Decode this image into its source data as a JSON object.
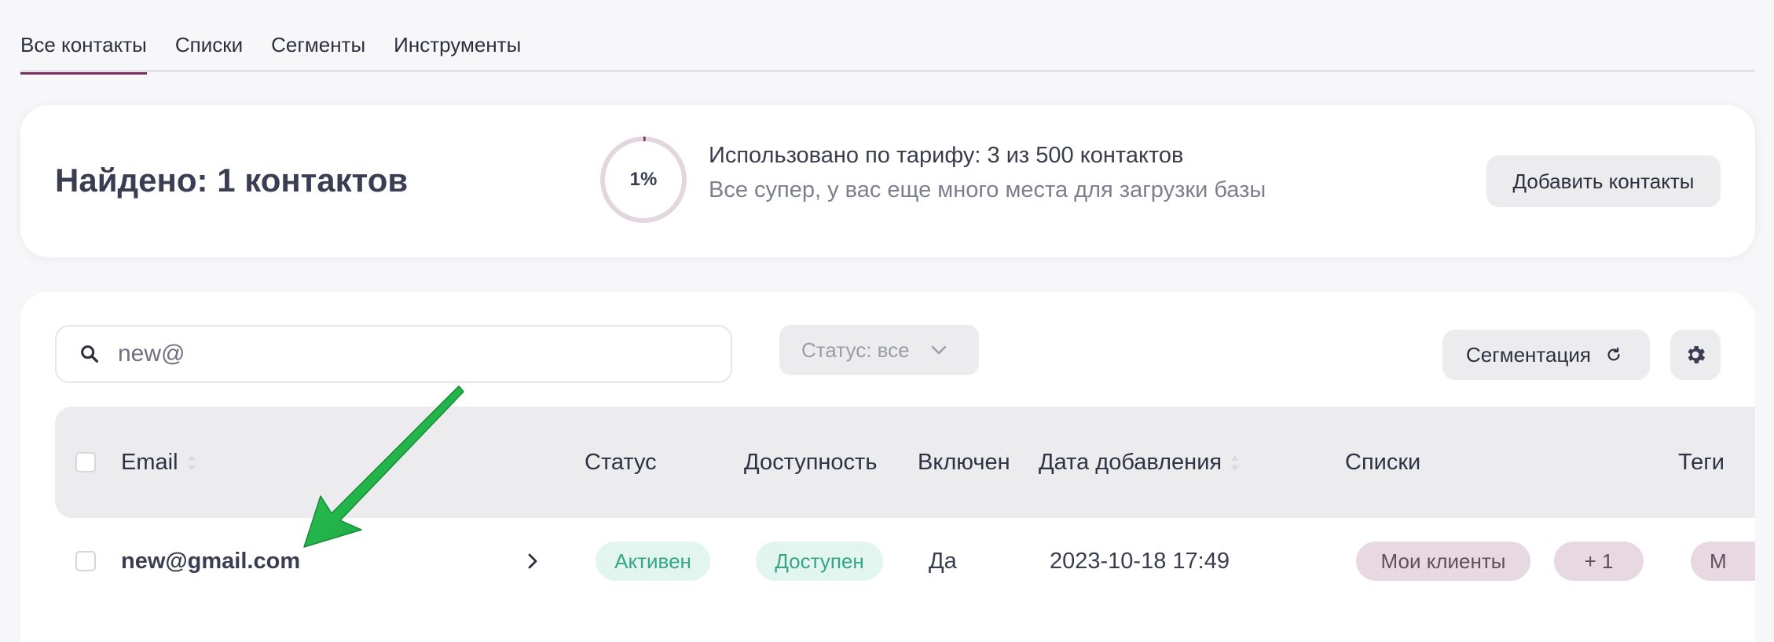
{
  "tabs": [
    {
      "label": "Все контакты",
      "active": true
    },
    {
      "label": "Списки",
      "active": false
    },
    {
      "label": "Сегменты",
      "active": false
    },
    {
      "label": "Инструменты",
      "active": false
    }
  ],
  "summary": {
    "found": "Найдено: 1 контактов",
    "usage_percent_label": "1%",
    "usage_fraction": 0.006,
    "usage_line1": "Использовано по тарифу: 3 из 500 контактов",
    "usage_line2": "Все супер, у вас еще много места для загрузки базы",
    "add_button": "Добавить контакты"
  },
  "toolbar": {
    "search_value": "new@",
    "status_filter": "Статус: все",
    "segmentation_button": "Сегментация"
  },
  "table": {
    "headers": {
      "email": "Email",
      "status": "Статус",
      "availability": "Доступность",
      "enabled": "Включен",
      "date_added": "Дата добавления",
      "lists": "Списки",
      "tags": "Теги"
    },
    "rows": [
      {
        "email": "new@gmail.com",
        "status": "Активен",
        "availability": "Доступен",
        "enabled": "Да",
        "date_added": "2023-10-18 17:49",
        "list": "Мои клиенты",
        "more_lists": "+ 1",
        "tag": "М"
      }
    ]
  },
  "colors": {
    "accent": "#7a2f62",
    "green_badge_bg": "#e3f5ef",
    "green_badge_text": "#35a487",
    "mauve_badge_bg": "#e7d8e2",
    "annotation_arrow": "#22b14c"
  }
}
